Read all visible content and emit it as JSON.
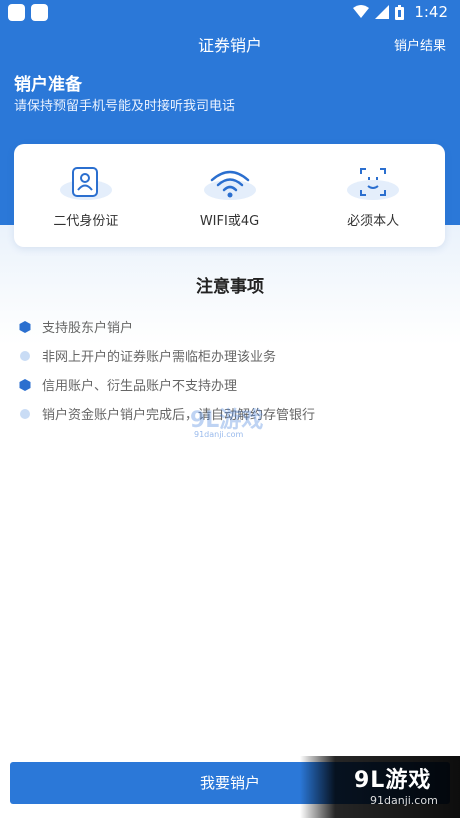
{
  "status_bar": {
    "time": "1:42"
  },
  "header": {
    "title": "证券销户",
    "result_link": "销户结果"
  },
  "prep": {
    "title": "销户准备",
    "subtitle": "请保持预留手机号能及时接听我司电话"
  },
  "requirements": [
    {
      "label": "二代身份证",
      "icon": "id-card-icon"
    },
    {
      "label": "WIFI或4G",
      "icon": "wifi-icon"
    },
    {
      "label": "必须本人",
      "icon": "face-scan-icon"
    }
  ],
  "notice": {
    "title": "注意事项",
    "items": [
      {
        "text": "支持股东户销户",
        "bullet": "hexagon"
      },
      {
        "text": "非网上开户的证券账户需临柜办理该业务",
        "bullet": "dot"
      },
      {
        "text": "信用账户、衍生品账户不支持办理",
        "bullet": "hexagon"
      },
      {
        "text": "销户资金账户销户完成后，请自动解约存管银行",
        "bullet": "dot"
      }
    ]
  },
  "submit_button": {
    "label": "我要销户"
  },
  "watermark": {
    "brand": "9L游戏",
    "url": "91danji.com"
  },
  "colors": {
    "primary": "#2b78d8",
    "bullet_dark": "#2b6fcf",
    "bullet_light": "#c9dcf5"
  }
}
